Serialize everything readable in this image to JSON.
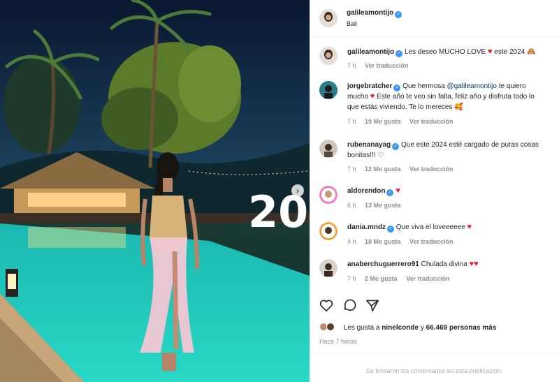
{
  "post": {
    "author": "galileamontijo",
    "location": "Bali"
  },
  "comments": [
    {
      "user": "galileamontijo",
      "text": "Les deseo MUCHO LOVE",
      "after": "este 2024",
      "emoji_end": "🙈",
      "time": "7 h",
      "likes": "",
      "translate": "Ver traducción"
    },
    {
      "user": "jorgebratcher",
      "text_pre": "Que hermosa",
      "mention": "@galileamontijo",
      "text_post": "te quiero",
      "line2": "mucho",
      "line3": "Este año te veo sin falta, feliz año y disfruta todo lo",
      "line4": "que estás viviendo. Te lo mereces",
      "time": "7 h",
      "likes": "19 Me gusta",
      "translate": "Ver traducción"
    },
    {
      "user": "rubenanayag",
      "text": "Que este 2024 esté cargado de puras cosas",
      "line2": "bonitas!!!",
      "time": "7 h",
      "likes": "12 Me gusta",
      "translate": "Ver traducción"
    },
    {
      "user": "aldorendon",
      "text": "",
      "time": "6 h",
      "likes": "13 Me gusta",
      "translate": ""
    },
    {
      "user": "dania.mndz",
      "text": "Que viva el loveeeeee",
      "time": "4 h",
      "likes": "18 Me gusta",
      "translate": "Ver traducción"
    },
    {
      "user": "anaberchuguerrero91",
      "text": "Chulada divina",
      "time": "7 h",
      "likes": "2 Me gusta",
      "translate": "Ver traducción"
    }
  ],
  "likes_line": {
    "prefix": "Les gusta a",
    "user": "ninelconde",
    "middle": "y",
    "count": "66.469 personas más"
  },
  "time_ago": "Hace 7 horas",
  "footer_text": "Se limitaron los comentarios en esta publicación.",
  "photo_sign": "20",
  "colors": {
    "verified": "#3897f0",
    "heart": "#ed1c2e",
    "muted": "#8e8e8e",
    "pool": "#2fd3c3"
  },
  "icons": [
    "heart-outline-icon",
    "comment-icon",
    "share-icon",
    "verified-icon",
    "carousel-next-icon"
  ]
}
